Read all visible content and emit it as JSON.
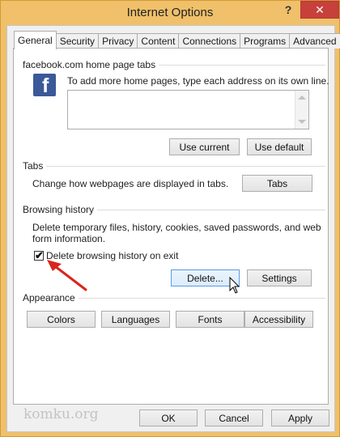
{
  "window": {
    "title": "Internet Options",
    "help_glyph": "?",
    "close_glyph": "✕"
  },
  "tabs": [
    "General",
    "Security",
    "Privacy",
    "Content",
    "Connections",
    "Programs",
    "Advanced"
  ],
  "home_page": {
    "group_title": "facebook.com home page tabs",
    "icon_letter": "f",
    "instruction": "To add more home pages, type each address on its own line.",
    "textarea_value": "",
    "use_current": "Use current",
    "use_default": "Use default"
  },
  "tabs_section": {
    "group_title": "Tabs",
    "description": "Change how webpages are displayed in tabs.",
    "button": "Tabs"
  },
  "browsing_history": {
    "group_title": "Browsing history",
    "description_line1": "Delete temporary files, history, cookies, saved passwords, and web",
    "description_line2": "form information.",
    "checkbox_label": "Delete browsing history on exit",
    "checkbox_checked": true,
    "delete_button": "Delete...",
    "settings_button": "Settings"
  },
  "appearance": {
    "group_title": "Appearance",
    "colors": "Colors",
    "languages": "Languages",
    "fonts": "Fonts",
    "accessibility": "Accessibility"
  },
  "footer": {
    "ok": "OK",
    "cancel": "Cancel",
    "apply": "Apply",
    "watermark": "komku.org"
  },
  "colors": {
    "frame": "#f0c06a",
    "close_button": "#c7403a",
    "facebook_blue": "#3b5998",
    "annotation_arrow": "#d9251c"
  }
}
